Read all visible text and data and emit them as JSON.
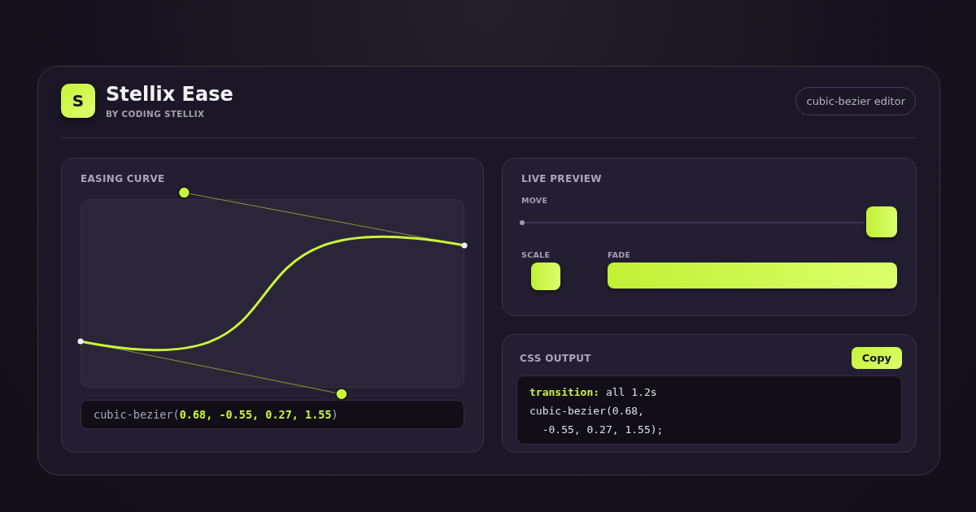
{
  "app": {
    "logo_letter": "S",
    "title": "Stellix Ease",
    "subtitle": "BY CODING STELLIX",
    "badge": "cubic-bezier editor"
  },
  "curve_panel": {
    "title": "EASING CURVE",
    "readout": "cubic-bezier(**0.68, -0.55, 0.27, 1.55**)"
  },
  "preview_panel": {
    "title": "LIVE PREVIEW",
    "move": {
      "label": "MOVE"
    },
    "scale": {
      "label": "SCALE"
    },
    "fade": {
      "label": "FADE"
    }
  },
  "css_panel": {
    "title": "CSS OUTPUT",
    "button": "Copy",
    "lines": [
      "**transition:** all 1.2s",
      "cubic-bezier(0.68,",
      "  -0.55, 0.27, 1.55);"
    ]
  }
}
